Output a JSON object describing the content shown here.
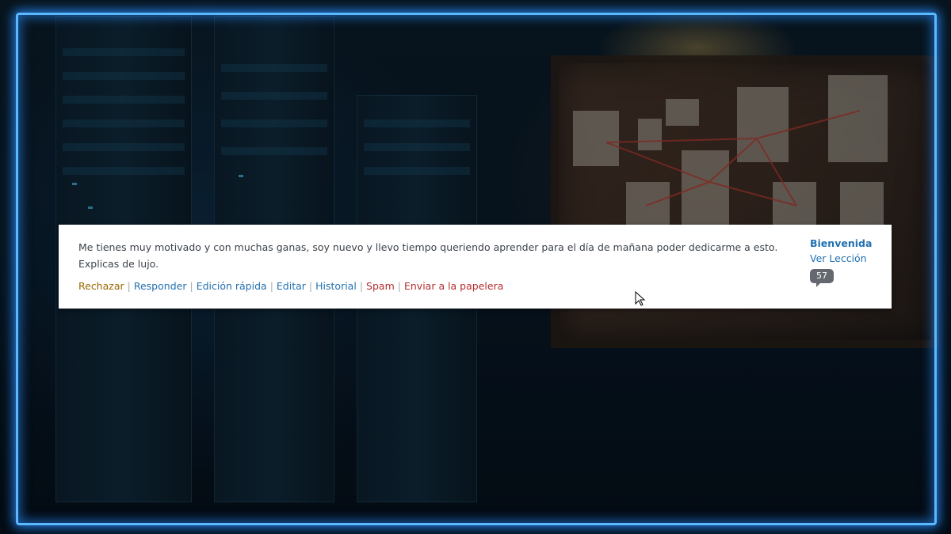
{
  "comment": {
    "text": "Me tienes muy motivado y con muchas ganas, soy nuevo y llevo tiempo queriendo aprender para el día de mañana poder dedicarme a esto. Explicas de lujo.",
    "actions": {
      "reject": "Rechazar",
      "reply": "Responder",
      "quick_edit": "Edición rápida",
      "edit": "Editar",
      "history": "Historial",
      "spam": "Spam",
      "trash": "Enviar a la papelera",
      "separator": "|"
    }
  },
  "in_response_to": {
    "post_title": "Bienvenida",
    "view_link": "Ver Lección",
    "comment_count": "57"
  },
  "colors": {
    "frame_glow": "#5ab8ff",
    "link": "#2271b1",
    "reject": "#996800",
    "danger": "#b32d2e"
  }
}
